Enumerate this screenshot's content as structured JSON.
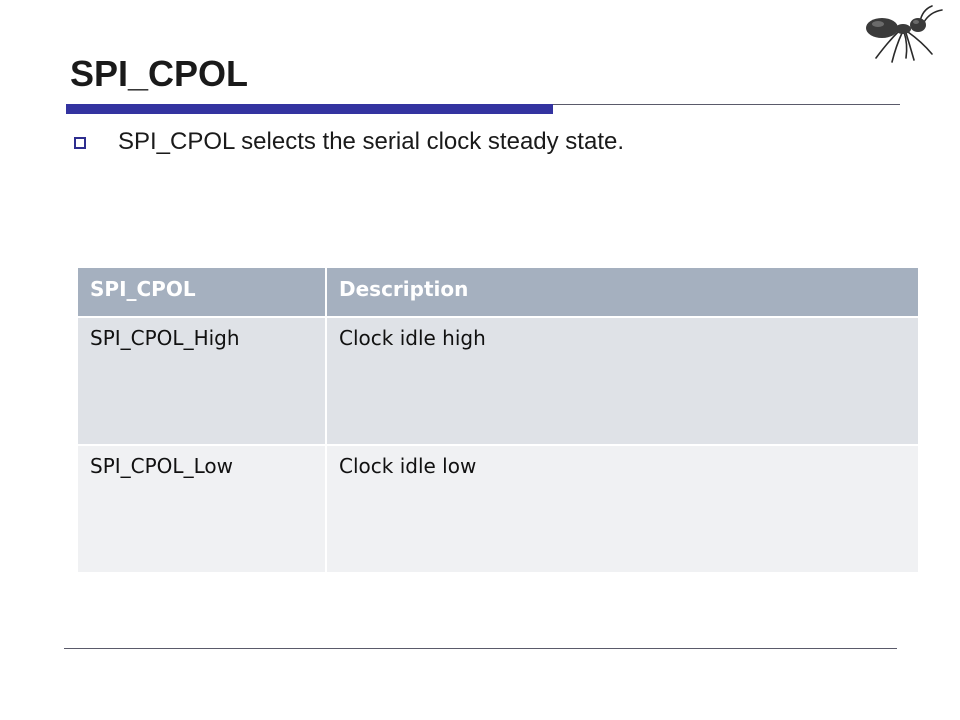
{
  "slide": {
    "title": "SPI_CPOL",
    "bullet": "SPI_CPOL selects the serial clock steady state."
  },
  "table": {
    "headers": [
      "SPI_CPOL",
      "Description"
    ],
    "rows": [
      [
        "SPI_CPOL_High",
        "Clock idle high"
      ],
      [
        "SPI_CPOL_Low",
        "Clock idle low"
      ]
    ]
  },
  "icons": {
    "logo": "ant-logo-icon",
    "bullet": "hollow-square-bullet-icon"
  },
  "colors": {
    "accent": "#3333a0",
    "header_bg": "#a5b0bf",
    "row_a_bg": "#dfe2e7",
    "row_b_bg": "#f0f1f3"
  }
}
